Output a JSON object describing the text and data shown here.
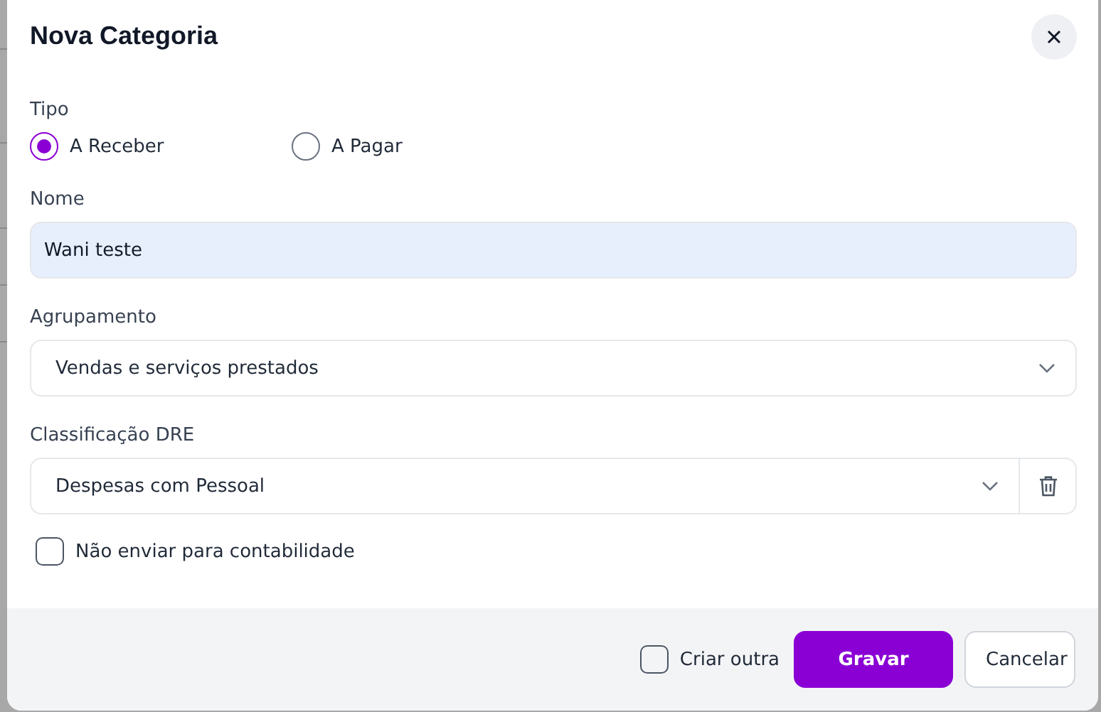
{
  "dialog": {
    "title": "Nova Categoria"
  },
  "tipo": {
    "label": "Tipo",
    "options": [
      {
        "label": "A Receber",
        "selected": true
      },
      {
        "label": "A Pagar",
        "selected": false
      }
    ]
  },
  "nome": {
    "label": "Nome",
    "value": "Wani teste"
  },
  "agrupamento": {
    "label": "Agrupamento",
    "value": "Vendas e serviços prestados"
  },
  "classificacao": {
    "label": "Classificação DRE",
    "value": "Despesas com Pessoal"
  },
  "nao_enviar": {
    "label": "Não enviar para contabilidade",
    "checked": false
  },
  "footer": {
    "criar_outra": {
      "label": "Criar outra",
      "checked": false
    },
    "buttons": [
      {
        "label": "Gravar",
        "kind": "primary"
      },
      {
        "label": "Cancelar",
        "kind": "secondary"
      }
    ]
  }
}
